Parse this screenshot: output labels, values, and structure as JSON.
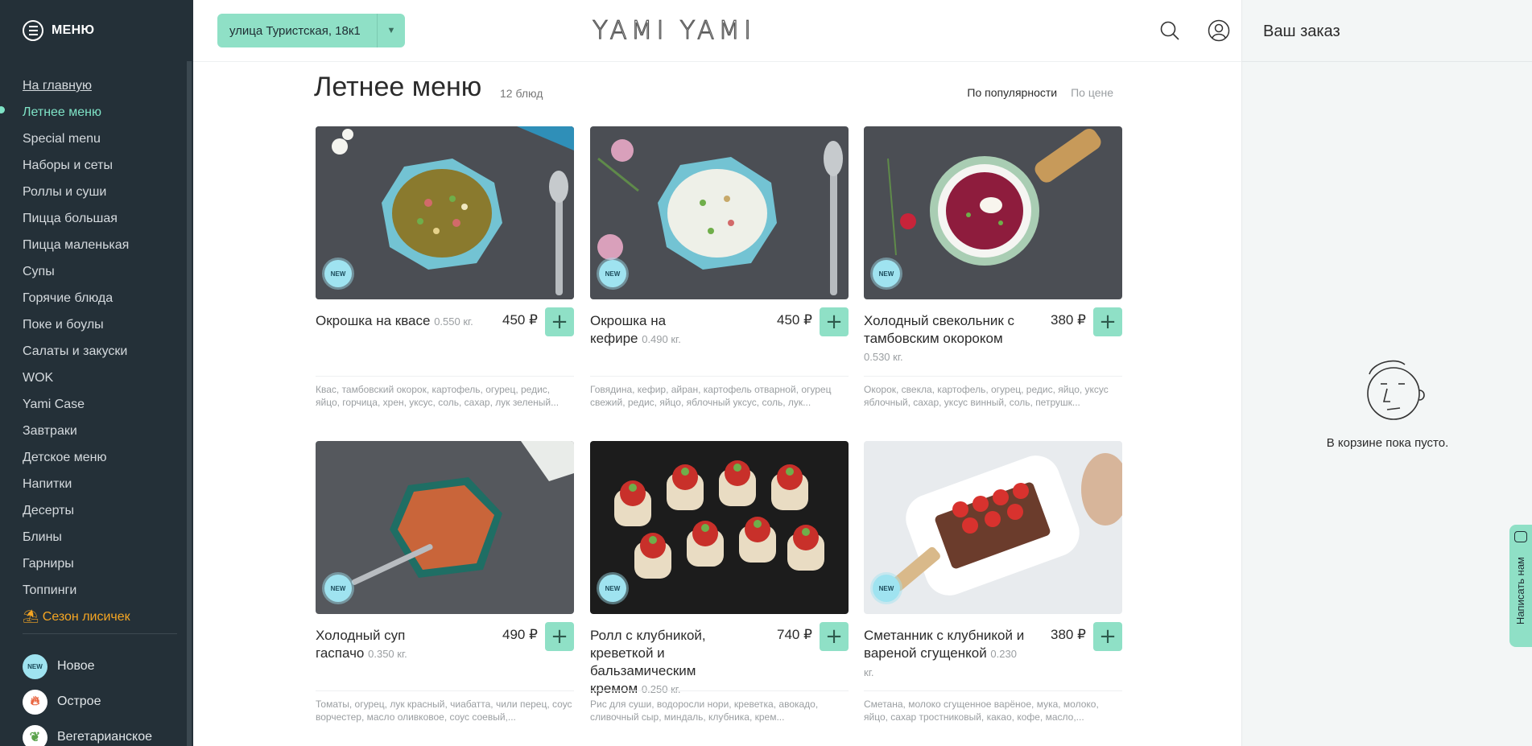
{
  "sidebar": {
    "title": "МЕНЮ",
    "items": [
      {
        "label": "На главную"
      },
      {
        "label": "Летнее меню"
      },
      {
        "label": "Special menu"
      },
      {
        "label": "Наборы и сеты"
      },
      {
        "label": "Роллы и суши"
      },
      {
        "label": "Пицца большая"
      },
      {
        "label": "Пицца маленькая"
      },
      {
        "label": "Супы"
      },
      {
        "label": "Горячие блюда"
      },
      {
        "label": "Поке и боулы"
      },
      {
        "label": "Салаты и закуски"
      },
      {
        "label": "WOK"
      },
      {
        "label": "Yami Case"
      },
      {
        "label": "Завтраки"
      },
      {
        "label": "Детское меню"
      },
      {
        "label": "Напитки"
      },
      {
        "label": "Десерты"
      },
      {
        "label": "Блины"
      },
      {
        "label": "Гарниры"
      },
      {
        "label": "Топпинги"
      },
      {
        "label": "Сезон лисичек"
      }
    ],
    "tags": [
      {
        "badge": "NEW",
        "label": "Новое"
      },
      {
        "badge": "",
        "label": "Острое"
      },
      {
        "badge": "",
        "label": "Вегетарианское"
      }
    ]
  },
  "header": {
    "address": "улица Туристская, 18к1",
    "logo": "YAMI YAMI"
  },
  "main": {
    "title": "Летнее меню",
    "count": "12 блюд",
    "sort_popular": "По популярности",
    "sort_price": "По цене",
    "badge_new": "NEW",
    "add_symbol": "+",
    "products": [
      {
        "name": "Окрошка на квасе",
        "weight": "0.550 кг.",
        "price": "450 ₽",
        "desc": "Квас, тамбовский окорок, картофель, огурец, редис, яйцо, горчица, хрен, уксус, соль, сахар, лук зеленый..."
      },
      {
        "name": "Окрошка на кефире",
        "weight": "0.490 кг.",
        "price": "450 ₽",
        "desc": "Говядина, кефир, айран, картофель отварной, огурец свежий, редис, яйцо, яблочный уксус, соль, лук..."
      },
      {
        "name": "Холодный свекольник с тамбовским окороком",
        "weight": "0.530 кг.",
        "price": "380 ₽",
        "desc": "Окорок, свекла, картофель, огурец, редис, яйцо, уксус яблочный, сахар, уксус винный, соль, петрушк..."
      },
      {
        "name": "Холодный суп гаспачо",
        "weight": "0.350 кг.",
        "price": "490 ₽",
        "desc": "Томаты, огурец, лук красный, чиабатта, чили перец, соус ворчестер, масло оливковое, соус соевый,..."
      },
      {
        "name": "Ролл с клубникой, креветкой и бальзамическим кремом",
        "weight": "0.250 кг.",
        "price": "740 ₽",
        "desc": "Рис для суши, водоросли нори, креветка, авокадо, сливочный сыр, миндаль, клубника, крем..."
      },
      {
        "name": "Сметанник с клубникой и вареной сгущенкой",
        "weight": "0.230 кг.",
        "price": "380 ₽",
        "desc": "Сметана, молоко сгущенное варёное, мука, молоко, яйцо, сахар тростниковый, какао, кофе, масло,..."
      }
    ]
  },
  "cart": {
    "title": "Ваш заказ",
    "empty": "В корзине пока пусто.",
    "write_us": "Написать нам"
  },
  "colors": {
    "accent": "#8fe0c6",
    "sidebar_bg": "#243038",
    "season": "#f5a623",
    "badge_new": "#9fe3f0"
  }
}
